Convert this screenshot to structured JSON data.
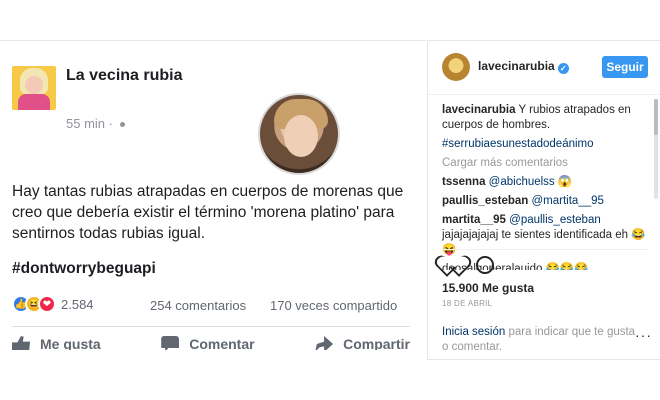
{
  "fb_post": {
    "author": "La vecina rubia",
    "time": "55 min ·",
    "text": "Hay tantas rubias atrapadas en cuerpos de morenas que creo que debería existir el término 'morena platino' para sentirnos todas rubias igual.",
    "hashtag": "#dontworrybeguapi",
    "reaction_count": "2.584",
    "comments": "254 comentarios",
    "shares": "170 veces compartido",
    "actions": {
      "like": "Me gusta",
      "comment": "Comentar",
      "share": "Compartir"
    },
    "reaction_icons": [
      "like-icon",
      "haha-icon",
      "love-icon"
    ],
    "colors": {
      "like": "#2f7bf2",
      "haha": "#f7b125",
      "love": "#f0284a"
    }
  },
  "ig": {
    "username": "lavecinarubia",
    "follow_label": "Seguir",
    "caption_user": "lavecinarubia",
    "caption_text": " Y rubios atrapados en cuerpos de hombres.",
    "caption_hashtag": "#serrubiaesunestadodeánimo",
    "load_more": "Cargar más comentarios",
    "comments": [
      {
        "user": "tssenna",
        "mention": "@abichuelss",
        "text": " 😱"
      },
      {
        "user": "paullis_esteban",
        "mention": "@martita__95",
        "text": ""
      },
      {
        "user": "martita__95",
        "mention": "@paullis_esteban",
        "text": " jajajajajajaj te sientes identificada eh 😂😝"
      }
    ],
    "cut_comment": "doosalgoneralauido 😂😂😂",
    "likes": "15.900 Me gusta",
    "date": "18 DE ABRIL",
    "login_link": "Inicia sesión",
    "login_text": " para indicar que te gusta o comentar.",
    "more": "···",
    "accent": "#3897f0"
  }
}
